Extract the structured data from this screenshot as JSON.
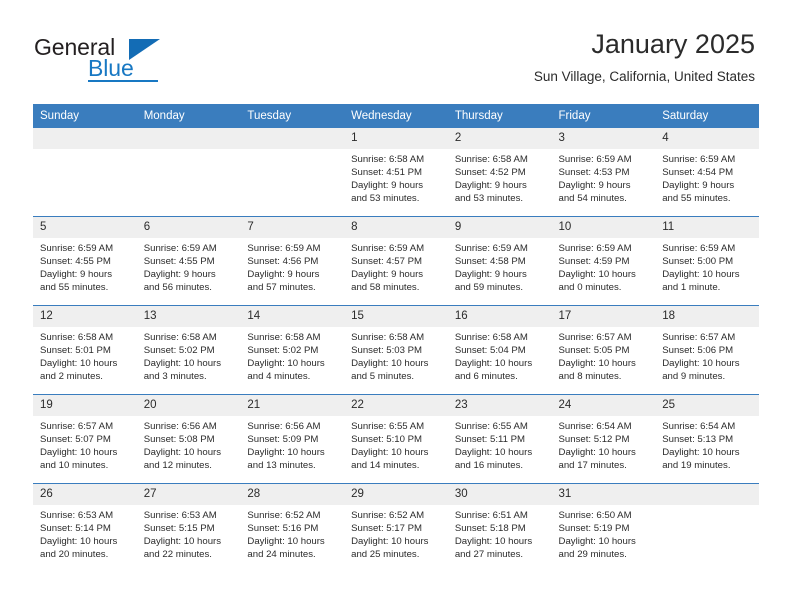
{
  "brand": {
    "name_part1": "General",
    "name_part2": "Blue",
    "logo_icon": "triangle-play-icon",
    "accent_color": "#1878c3"
  },
  "header": {
    "month_title": "January 2025",
    "location": "Sun Village, California, United States"
  },
  "theme": {
    "header_row_bg": "#3a7dbe",
    "daynum_bg": "#efefef",
    "text_color": "#2b2b2b",
    "page_bg": "#ffffff"
  },
  "calendar": {
    "columns": [
      "Sunday",
      "Monday",
      "Tuesday",
      "Wednesday",
      "Thursday",
      "Friday",
      "Saturday"
    ],
    "weeks": [
      [
        {
          "day": "",
          "lines": []
        },
        {
          "day": "",
          "lines": []
        },
        {
          "day": "",
          "lines": []
        },
        {
          "day": "1",
          "lines": [
            "Sunrise: 6:58 AM",
            "Sunset: 4:51 PM",
            "Daylight: 9 hours",
            "and 53 minutes."
          ]
        },
        {
          "day": "2",
          "lines": [
            "Sunrise: 6:58 AM",
            "Sunset: 4:52 PM",
            "Daylight: 9 hours",
            "and 53 minutes."
          ]
        },
        {
          "day": "3",
          "lines": [
            "Sunrise: 6:59 AM",
            "Sunset: 4:53 PM",
            "Daylight: 9 hours",
            "and 54 minutes."
          ]
        },
        {
          "day": "4",
          "lines": [
            "Sunrise: 6:59 AM",
            "Sunset: 4:54 PM",
            "Daylight: 9 hours",
            "and 55 minutes."
          ]
        }
      ],
      [
        {
          "day": "5",
          "lines": [
            "Sunrise: 6:59 AM",
            "Sunset: 4:55 PM",
            "Daylight: 9 hours",
            "and 55 minutes."
          ]
        },
        {
          "day": "6",
          "lines": [
            "Sunrise: 6:59 AM",
            "Sunset: 4:55 PM",
            "Daylight: 9 hours",
            "and 56 minutes."
          ]
        },
        {
          "day": "7",
          "lines": [
            "Sunrise: 6:59 AM",
            "Sunset: 4:56 PM",
            "Daylight: 9 hours",
            "and 57 minutes."
          ]
        },
        {
          "day": "8",
          "lines": [
            "Sunrise: 6:59 AM",
            "Sunset: 4:57 PM",
            "Daylight: 9 hours",
            "and 58 minutes."
          ]
        },
        {
          "day": "9",
          "lines": [
            "Sunrise: 6:59 AM",
            "Sunset: 4:58 PM",
            "Daylight: 9 hours",
            "and 59 minutes."
          ]
        },
        {
          "day": "10",
          "lines": [
            "Sunrise: 6:59 AM",
            "Sunset: 4:59 PM",
            "Daylight: 10 hours",
            "and 0 minutes."
          ]
        },
        {
          "day": "11",
          "lines": [
            "Sunrise: 6:59 AM",
            "Sunset: 5:00 PM",
            "Daylight: 10 hours",
            "and 1 minute."
          ]
        }
      ],
      [
        {
          "day": "12",
          "lines": [
            "Sunrise: 6:58 AM",
            "Sunset: 5:01 PM",
            "Daylight: 10 hours",
            "and 2 minutes."
          ]
        },
        {
          "day": "13",
          "lines": [
            "Sunrise: 6:58 AM",
            "Sunset: 5:02 PM",
            "Daylight: 10 hours",
            "and 3 minutes."
          ]
        },
        {
          "day": "14",
          "lines": [
            "Sunrise: 6:58 AM",
            "Sunset: 5:02 PM",
            "Daylight: 10 hours",
            "and 4 minutes."
          ]
        },
        {
          "day": "15",
          "lines": [
            "Sunrise: 6:58 AM",
            "Sunset: 5:03 PM",
            "Daylight: 10 hours",
            "and 5 minutes."
          ]
        },
        {
          "day": "16",
          "lines": [
            "Sunrise: 6:58 AM",
            "Sunset: 5:04 PM",
            "Daylight: 10 hours",
            "and 6 minutes."
          ]
        },
        {
          "day": "17",
          "lines": [
            "Sunrise: 6:57 AM",
            "Sunset: 5:05 PM",
            "Daylight: 10 hours",
            "and 8 minutes."
          ]
        },
        {
          "day": "18",
          "lines": [
            "Sunrise: 6:57 AM",
            "Sunset: 5:06 PM",
            "Daylight: 10 hours",
            "and 9 minutes."
          ]
        }
      ],
      [
        {
          "day": "19",
          "lines": [
            "Sunrise: 6:57 AM",
            "Sunset: 5:07 PM",
            "Daylight: 10 hours",
            "and 10 minutes."
          ]
        },
        {
          "day": "20",
          "lines": [
            "Sunrise: 6:56 AM",
            "Sunset: 5:08 PM",
            "Daylight: 10 hours",
            "and 12 minutes."
          ]
        },
        {
          "day": "21",
          "lines": [
            "Sunrise: 6:56 AM",
            "Sunset: 5:09 PM",
            "Daylight: 10 hours",
            "and 13 minutes."
          ]
        },
        {
          "day": "22",
          "lines": [
            "Sunrise: 6:55 AM",
            "Sunset: 5:10 PM",
            "Daylight: 10 hours",
            "and 14 minutes."
          ]
        },
        {
          "day": "23",
          "lines": [
            "Sunrise: 6:55 AM",
            "Sunset: 5:11 PM",
            "Daylight: 10 hours",
            "and 16 minutes."
          ]
        },
        {
          "day": "24",
          "lines": [
            "Sunrise: 6:54 AM",
            "Sunset: 5:12 PM",
            "Daylight: 10 hours",
            "and 17 minutes."
          ]
        },
        {
          "day": "25",
          "lines": [
            "Sunrise: 6:54 AM",
            "Sunset: 5:13 PM",
            "Daylight: 10 hours",
            "and 19 minutes."
          ]
        }
      ],
      [
        {
          "day": "26",
          "lines": [
            "Sunrise: 6:53 AM",
            "Sunset: 5:14 PM",
            "Daylight: 10 hours",
            "and 20 minutes."
          ]
        },
        {
          "day": "27",
          "lines": [
            "Sunrise: 6:53 AM",
            "Sunset: 5:15 PM",
            "Daylight: 10 hours",
            "and 22 minutes."
          ]
        },
        {
          "day": "28",
          "lines": [
            "Sunrise: 6:52 AM",
            "Sunset: 5:16 PM",
            "Daylight: 10 hours",
            "and 24 minutes."
          ]
        },
        {
          "day": "29",
          "lines": [
            "Sunrise: 6:52 AM",
            "Sunset: 5:17 PM",
            "Daylight: 10 hours",
            "and 25 minutes."
          ]
        },
        {
          "day": "30",
          "lines": [
            "Sunrise: 6:51 AM",
            "Sunset: 5:18 PM",
            "Daylight: 10 hours",
            "and 27 minutes."
          ]
        },
        {
          "day": "31",
          "lines": [
            "Sunrise: 6:50 AM",
            "Sunset: 5:19 PM",
            "Daylight: 10 hours",
            "and 29 minutes."
          ]
        },
        {
          "day": "",
          "lines": []
        }
      ]
    ]
  }
}
